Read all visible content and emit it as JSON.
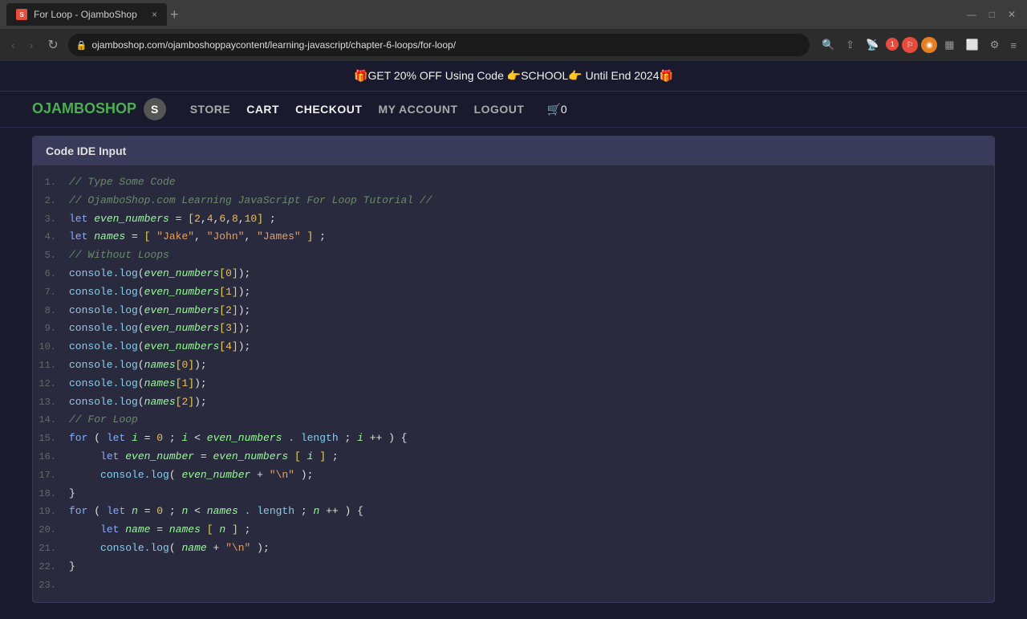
{
  "browser": {
    "tab": {
      "title": "For Loop - OjamboShop",
      "favicon_label": "S",
      "close_label": "×"
    },
    "new_tab_label": "+",
    "nav": {
      "back_label": "‹",
      "forward_label": "›",
      "reload_label": "↻",
      "address": "ojamboshop.com/ojamboshoppaycontent/learning-javascript/chapter-6-loops/for-loop/",
      "address_icon": "🔒"
    },
    "window_controls": {
      "minimize": "—",
      "maximize": "□",
      "close": "×"
    }
  },
  "site": {
    "promo_banner": "🎁GET 20% OFF Using Code 👉SCHOOL👉 Until End 2024🎁",
    "logo": "OJAMBOSHOP",
    "logo_icon": "S",
    "nav": {
      "store": "STORE",
      "cart": "CART",
      "checkout": "CHECKOUT",
      "myaccount": "MY ACCOUNT",
      "logout": "LOGOUT",
      "cart_count": "0"
    }
  },
  "ide": {
    "header": "Code IDE Input",
    "lines": [
      {
        "num": "1.",
        "code": "comment_type_some_code"
      },
      {
        "num": "2.",
        "code": "comment_ojambo"
      },
      {
        "num": "3.",
        "code": "let_even_numbers"
      },
      {
        "num": "4.",
        "code": "let_names"
      },
      {
        "num": "5.",
        "code": "comment_without_loops"
      },
      {
        "num": "6.",
        "code": "console_en0"
      },
      {
        "num": "7.",
        "code": "console_en1"
      },
      {
        "num": "8.",
        "code": "console_en2"
      },
      {
        "num": "9.",
        "code": "console_en3"
      },
      {
        "num": "10.",
        "code": "console_en4"
      },
      {
        "num": "11.",
        "code": "console_names0"
      },
      {
        "num": "12.",
        "code": "console_names1"
      },
      {
        "num": "13.",
        "code": "console_names2"
      },
      {
        "num": "14.",
        "code": "comment_for_loop"
      },
      {
        "num": "15.",
        "code": "for_loop1"
      },
      {
        "num": "16.",
        "code": "let_even_number"
      },
      {
        "num": "17.",
        "code": "console_even_number"
      },
      {
        "num": "18.",
        "code": "close_brace"
      },
      {
        "num": "19.",
        "code": "for_loop2"
      },
      {
        "num": "20.",
        "code": "let_name"
      },
      {
        "num": "21.",
        "code": "console_name"
      },
      {
        "num": "22.",
        "code": "close_brace"
      },
      {
        "num": "23.",
        "code": "empty"
      }
    ]
  }
}
